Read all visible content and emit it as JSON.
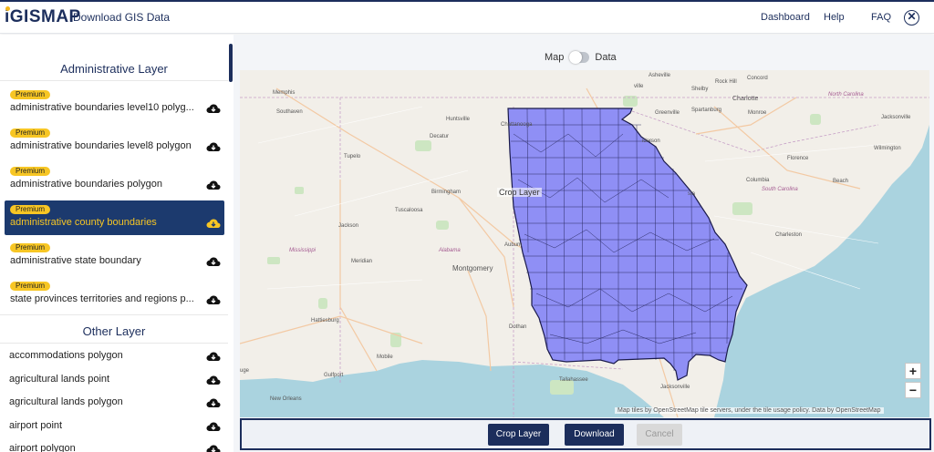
{
  "header": {
    "logo_text": "GISMAP",
    "logo_i": "i",
    "title": "Download GIS Data",
    "nav": [
      "Dashboard",
      "Help",
      "FAQ"
    ],
    "close_symbol": "✕"
  },
  "sidebar": {
    "administrative_title": "Administrative Layer",
    "premium_label": "Premium",
    "administrative_items": [
      {
        "label": "administrative boundaries level10 polyg...",
        "premium": true
      },
      {
        "label": "administrative boundaries level8 polygon",
        "premium": true
      },
      {
        "label": "administrative boundaries polygon",
        "premium": true
      },
      {
        "label": "administrative county boundaries",
        "premium": true,
        "selected": true
      },
      {
        "label": "administrative state boundary",
        "premium": true
      },
      {
        "label": "state provinces territories and regions p...",
        "premium": true
      }
    ],
    "other_title": "Other Layer",
    "other_items": [
      {
        "label": "accommodations polygon"
      },
      {
        "label": "agricultural lands point"
      },
      {
        "label": "agricultural lands polygon"
      },
      {
        "label": "airport point"
      },
      {
        "label": "airport polygon"
      }
    ]
  },
  "toggle": {
    "left": "Map",
    "right": "Data"
  },
  "map": {
    "labels": {
      "memphis": "Memphis",
      "southaven": "Southaven",
      "chattanooga": "Chattanooga",
      "huntsville": "Huntsville",
      "decatur": "Decatur",
      "tupelo": "Tupelo",
      "birmingham": "Birmingham",
      "tuscaloosa": "Tuscaloosa",
      "auburn": "Auburn",
      "montgomery": "Montgomery",
      "jackson": "Jackson",
      "meridian": "Meridian",
      "hattiesburg": "Hattiesburg",
      "mobile": "Mobile",
      "gulfport": "Gulfport",
      "new_orleans": "New Orleans",
      "dothan": "Dothan",
      "tallahassee": "Tallahassee",
      "jacksonville": "Jacksonville",
      "asheville": "Asheville",
      "shelby": "Shelby",
      "concord": "Concord",
      "charlotte": "Charlotte",
      "greenville": "Greenville",
      "spartanburg": "Spartanburg",
      "monroe": "Monroe",
      "columbia": "Columbia",
      "florence": "Florence",
      "wilmington": "Wilmington",
      "charleston": "Charleston",
      "ville": "ville",
      "iderson": "iderson",
      "sta": "sta",
      "mississippi": "Mississippi",
      "alabama": "Alabama",
      "north_carolina": "North Carolina",
      "south_carolina": "South Carolina",
      "beach": "Beach",
      "jacksonville_nc": "Jacksonville",
      "rock_hill": "Rock Hill",
      "uge": "uge"
    },
    "zoom_in": "+",
    "zoom_out": "−",
    "attribution": "Map tiles by OpenStreetMap tile servers, under the tile usage policy. Data by OpenStreetMap",
    "colors": {
      "land": "#f2efe9",
      "water": "#aad3df",
      "georgia_fill": "#8f8ff5",
      "county_line": "#1a1a4a"
    }
  },
  "buttons": {
    "crop": "Crop Layer",
    "download": "Download",
    "cancel": "Cancel"
  }
}
